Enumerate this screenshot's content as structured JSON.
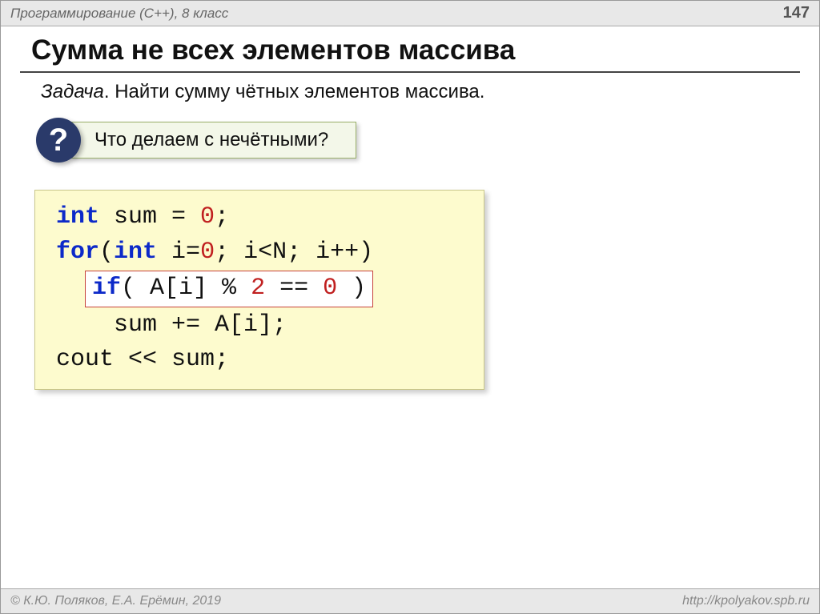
{
  "header": {
    "left": "Программирование (C++), 8 класс",
    "page": "147"
  },
  "title": "Сумма не всех элементов массива",
  "task": {
    "label": "Задача",
    "text": ". Найти сумму чётных элементов массива."
  },
  "question": {
    "badge": "?",
    "text": "Что делаем с нечётными?"
  },
  "code": {
    "l1a": "int",
    "l1b": " sum = ",
    "l1c": "0",
    "l1d": ";",
    "l2a": "for",
    "l2b": "(",
    "l2c": "int ",
    "l2d": "i=",
    "l2e": "0",
    "l2f": "; i<N; i++)",
    "l3a": "  ",
    "l3b": "if",
    "l3c": "( A[i] % ",
    "l3d": "2",
    "l3e": " == ",
    "l3f": "0",
    "l3g": " )",
    "l4": "    sum += A[i];",
    "l5": "cout << sum;"
  },
  "footer": {
    "left": "© К.Ю. Поляков, Е.А. Ерёмин, 2019",
    "right": "http://kpolyakov.spb.ru"
  }
}
